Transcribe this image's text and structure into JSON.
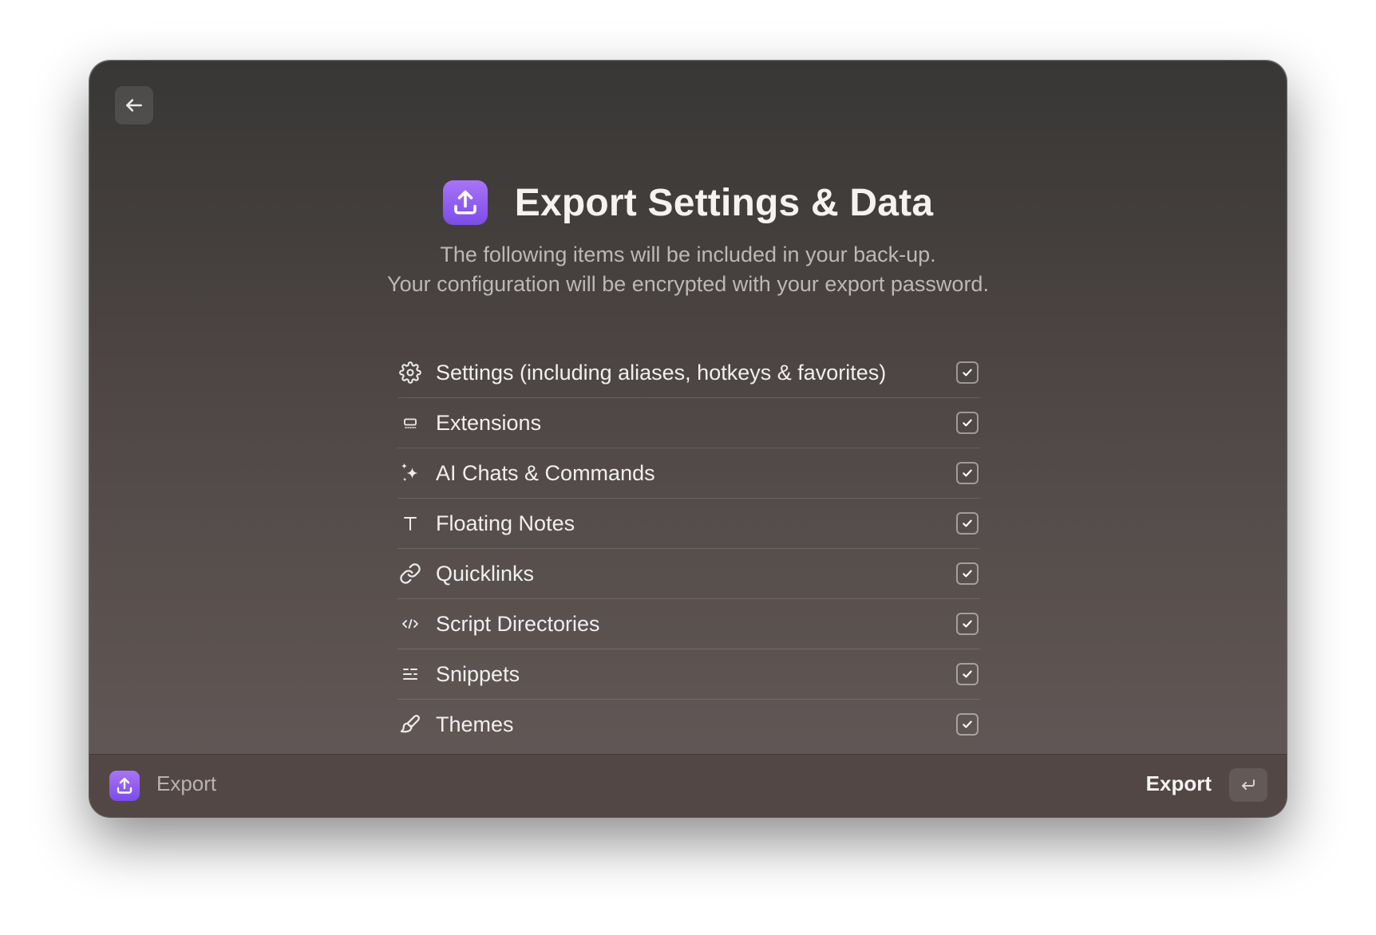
{
  "header": {
    "title": "Export Settings & Data",
    "subtitle_line1": "The following items will be included in your back-up.",
    "subtitle_line2": "Your configuration will be encrypted with your export password."
  },
  "items": [
    {
      "label": "Settings (including aliases, hotkeys & favorites)",
      "icon": "gear-icon",
      "checked": true
    },
    {
      "label": "Extensions",
      "icon": "extensions-icon",
      "checked": true
    },
    {
      "label": "AI Chats & Commands",
      "icon": "sparkles-icon",
      "checked": true
    },
    {
      "label": "Floating Notes",
      "icon": "text-icon",
      "checked": true
    },
    {
      "label": "Quicklinks",
      "icon": "link-icon",
      "checked": true
    },
    {
      "label": "Script Directories",
      "icon": "code-icon",
      "checked": true
    },
    {
      "label": "Snippets",
      "icon": "snippets-icon",
      "checked": true
    },
    {
      "label": "Themes",
      "icon": "brush-icon",
      "checked": true
    }
  ],
  "footer": {
    "title": "Export",
    "action_label": "Export",
    "action_key": "return"
  },
  "colors": {
    "accent": "#8b5cf6",
    "background_top": "#383735",
    "background_bottom": "#645958"
  }
}
